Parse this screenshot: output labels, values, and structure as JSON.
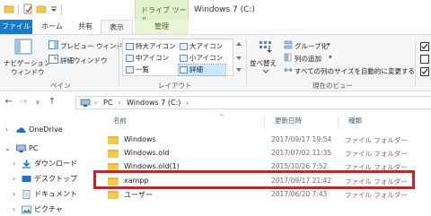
{
  "window": {
    "title": "Windows 7 (C:)"
  },
  "context_tab": {
    "header": "ドライブ ツール"
  },
  "tabs": [
    {
      "label": "ファイル"
    },
    {
      "label": "ホーム"
    },
    {
      "label": "共有"
    },
    {
      "label": "表示"
    },
    {
      "label": "管理"
    }
  ],
  "ribbon": {
    "pane_group": {
      "nav_pane_label": "ナビゲーション\nウィンドウ",
      "nav_pane_line1": "ナビゲーション",
      "nav_pane_line2": "ウィンドウ",
      "preview_label": "プレビュー ウィンドウ",
      "details_label": "詳細ウィンドウ",
      "group_label": "ペイン"
    },
    "layout_group": {
      "items": [
        {
          "label": "特大アイコン"
        },
        {
          "label": "大アイコン"
        },
        {
          "label": "中アイコン"
        },
        {
          "label": "小アイコン"
        },
        {
          "label": "一覧"
        },
        {
          "label": "詳細",
          "selected": true
        }
      ],
      "group_label": "レイアウト"
    },
    "view_group": {
      "sort_line1": "並べ替え",
      "group_by": "グループ化",
      "add_columns": "列の追加",
      "fit_columns": "すべての列のサイズを自動的に変更する",
      "group_label": "現在のビュー"
    }
  },
  "address": {
    "crumbs": [
      "PC",
      "Windows 7 (C:)"
    ]
  },
  "nav_pane": {
    "items": [
      {
        "label": "OneDrive"
      },
      {
        "label": "PC"
      },
      {
        "label": "ダウンロード"
      },
      {
        "label": "デスクトップ"
      },
      {
        "label": "ドキュメント"
      },
      {
        "label": "ピクチャ"
      }
    ]
  },
  "file_list": {
    "columns": {
      "name": "名前",
      "modified": "更新日時",
      "type": "種類"
    },
    "rows": [
      {
        "name": "Windows",
        "date": "2017/09/17 19:54",
        "type": "ファイル フォルダー"
      },
      {
        "name": "Windows.old",
        "date": "2017/07/02 11:35",
        "type": "ファイル フォルダー"
      },
      {
        "name": "Windows.old(1)",
        "date": "2015/10/26 7:52",
        "type": "ファイル フォルダー"
      },
      {
        "name": "xampp",
        "date": "2017/09/17 21:42",
        "type": "ファイル フォルダー",
        "highlighted": true
      },
      {
        "name": "ユーザー",
        "date": "2017/06/20 7:43",
        "type": "ファイル フォルダー"
      }
    ]
  },
  "colors": {
    "file_tab": "#1979ca",
    "highlight_border": "#c8232c",
    "selection": "#cce8ff",
    "context_tab_bg": "#e2f0cb",
    "folder": "#f3c84f"
  }
}
